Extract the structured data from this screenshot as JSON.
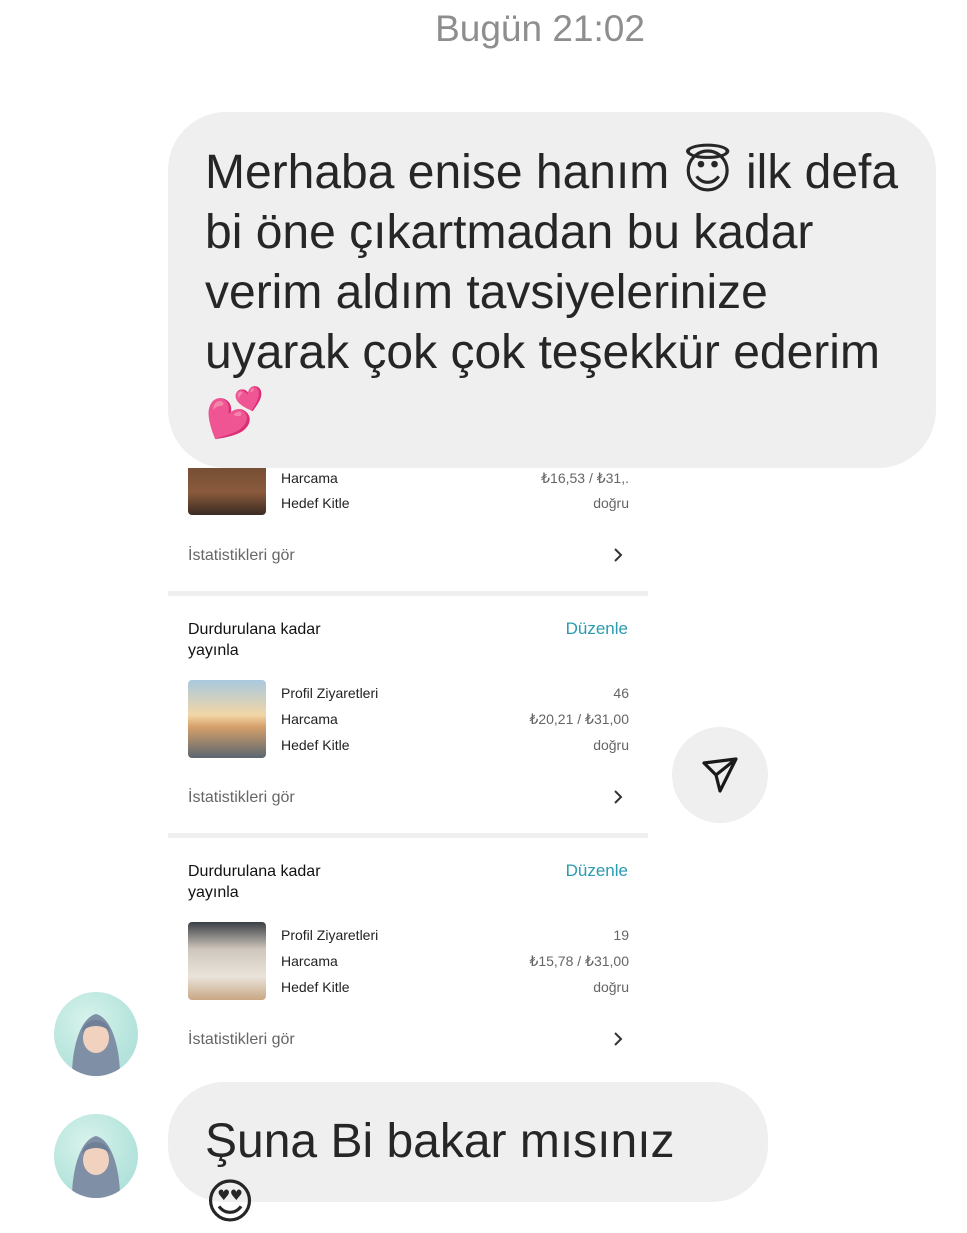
{
  "header": {
    "timestamp": "Bugün 21:02"
  },
  "messages": [
    {
      "text_parts": [
        "Merhaba enise hanım ",
        "😇",
        " ilk defa bi öne çıkartmadan bu kadar verim aldım tavsiyelerinize uyarak çok çok teşekkür ederim ",
        "💕"
      ]
    },
    {
      "text_parts": [
        "Şuna Bi bakar mısınız ",
        "😍"
      ]
    }
  ],
  "ads": [
    {
      "rows": [
        {
          "label": "Harcama",
          "value": "₺16,53 / ₺31,."
        },
        {
          "label": "Hedef Kitle",
          "value": "doğru"
        }
      ],
      "stats_label": "İstatistikleri gör"
    },
    {
      "title": "Durdurulana kadar yayınla",
      "edit_label": "Düzenle",
      "rows": [
        {
          "label": "Profil Ziyaretleri",
          "value": "46"
        },
        {
          "label": "Harcama",
          "value": "₺20,21 / ₺31,00"
        },
        {
          "label": "Hedef Kitle",
          "value": "doğru"
        }
      ],
      "stats_label": "İstatistikleri gör"
    },
    {
      "title": "Durdurulana kadar yayınla",
      "edit_label": "Düzenle",
      "rows": [
        {
          "label": "Profil Ziyaretleri",
          "value": "19"
        },
        {
          "label": "Harcama",
          "value": "₺15,78 / ₺31,00"
        },
        {
          "label": "Hedef Kitle",
          "value": "doğru"
        }
      ],
      "stats_label": "İstatistikleri gör"
    }
  ],
  "icons": {
    "send": "paper-plane-icon",
    "chevron": "chevron-right-icon"
  },
  "colors": {
    "bubble_bg": "#efefef",
    "edit_accent": "#2a9bb0",
    "timestamp": "#8e8e8e"
  }
}
